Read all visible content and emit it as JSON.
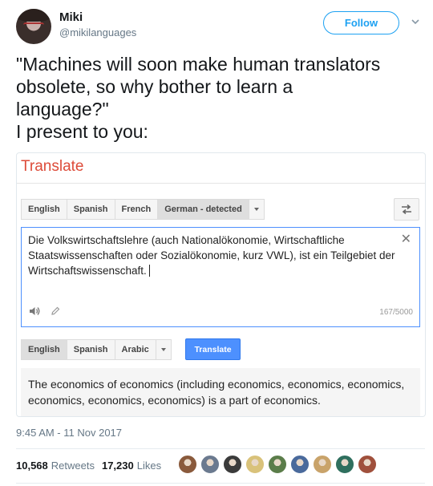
{
  "tweet": {
    "author_name": "Miki",
    "handle": "@mikilanguages",
    "follow_label": "Follow",
    "text_lines": [
      "\"Machines will soon make human translators",
      "obsolete, so why bother to learn a",
      "language?\"",
      "I present to you:"
    ],
    "timestamp": "9:45 AM - 11 Nov 2017",
    "retweets_count": "10,568",
    "retweets_label": "Retweets",
    "likes_count": "17,230",
    "likes_label": "Likes"
  },
  "translate": {
    "title": "Translate",
    "source_tabs": [
      "English",
      "Spanish",
      "French",
      "German - detected"
    ],
    "target_tabs": [
      "English",
      "Spanish",
      "Arabic"
    ],
    "translate_button": "Translate",
    "source_text": "Die Volkswirtschaftslehre (auch Nationalökonomie, Wirtschaftliche Staatswissenschaften oder Sozialökonomie, kurz VWL), ist ein Teilgebiet der Wirtschaftswissenschaft.",
    "char_count": "167/5000",
    "result_text": "The economics of economics (including economics, economics, economics, economics, economics, economics) is a part of economics.",
    "accent_color": "#dd4b39",
    "button_color": "#4d90fe"
  },
  "colors": {
    "brand_blue": "#1da1f2",
    "muted": "#657786"
  },
  "icons": [
    "chevron-down-icon",
    "swap-languages-icon",
    "clear-x-icon",
    "speaker-icon",
    "pencil-icon"
  ],
  "liker_colors": [
    "#8a5a3c",
    "#6b7a8f",
    "#3b3b3b",
    "#d9c27a",
    "#5b7d4a",
    "#4a6a9c",
    "#c9a36a",
    "#2f6f5e",
    "#a0503c"
  ]
}
